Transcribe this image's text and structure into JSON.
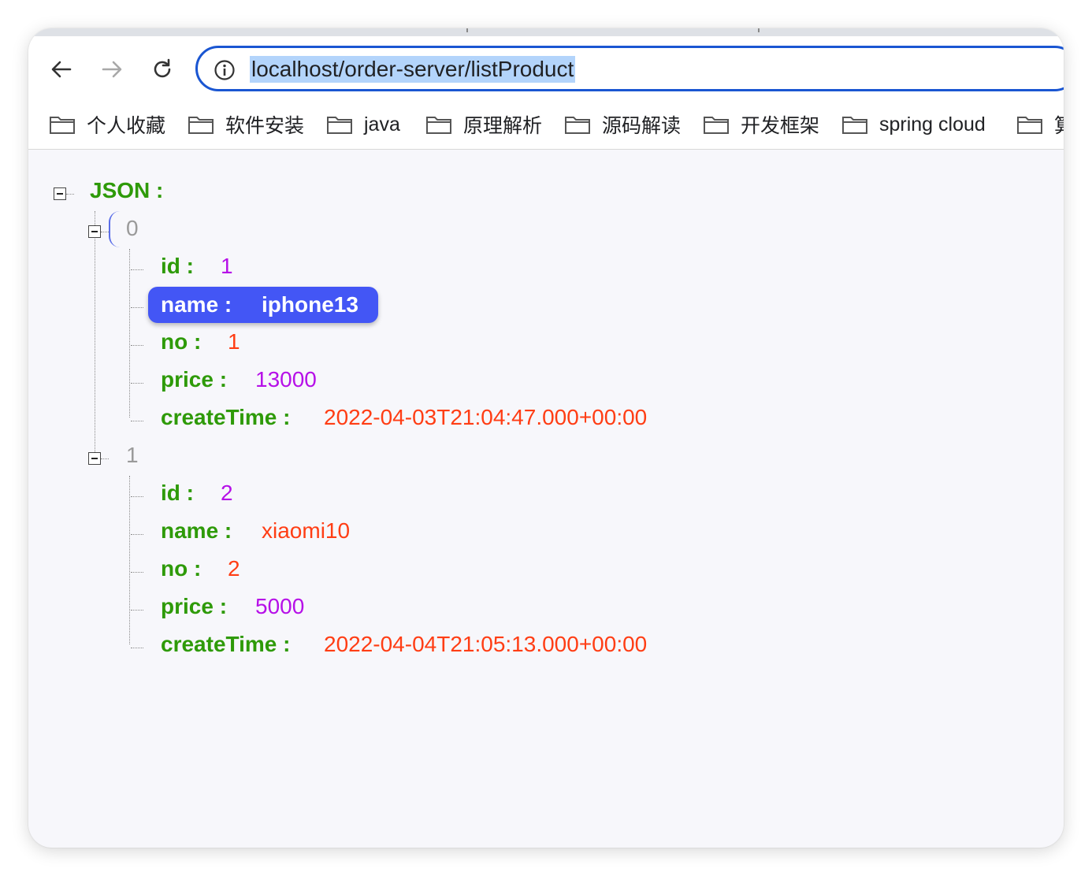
{
  "browser": {
    "url": "localhost/order-server/listProduct",
    "bookmarks": [
      "个人收藏",
      "软件安装",
      "java",
      "原理解析",
      "源码解读",
      "开发框架",
      "spring cloud",
      "算"
    ]
  },
  "json_tree": {
    "root_label": "JSON :",
    "items": [
      {
        "index": "0",
        "fields": [
          {
            "key": "id :",
            "value": "1"
          },
          {
            "key": "name :",
            "value": "iphone13"
          },
          {
            "key": "no :",
            "value": "1"
          },
          {
            "key": "price :",
            "value": "13000"
          },
          {
            "key": "createTime :",
            "value": "2022-04-03T21:04:47.000+00:00"
          }
        ]
      },
      {
        "index": "1",
        "fields": [
          {
            "key": "id :",
            "value": "2"
          },
          {
            "key": "name :",
            "value": "xiaomi10"
          },
          {
            "key": "no :",
            "value": "2"
          },
          {
            "key": "price :",
            "value": "5000"
          },
          {
            "key": "createTime :",
            "value": "2022-04-04T21:05:13.000+00:00"
          }
        ]
      }
    ]
  },
  "colors": {
    "key": "#2e9a08",
    "number": "#b610e8",
    "string": "#ff3d14",
    "selection": "#4356f5",
    "omnibox_border": "#1a56d2"
  },
  "icons": {
    "back": "arrow-left-icon",
    "forward": "arrow-right-icon",
    "reload": "reload-icon",
    "site_info": "info-icon",
    "folder": "folder-icon",
    "collapse": "minus-box-icon"
  }
}
